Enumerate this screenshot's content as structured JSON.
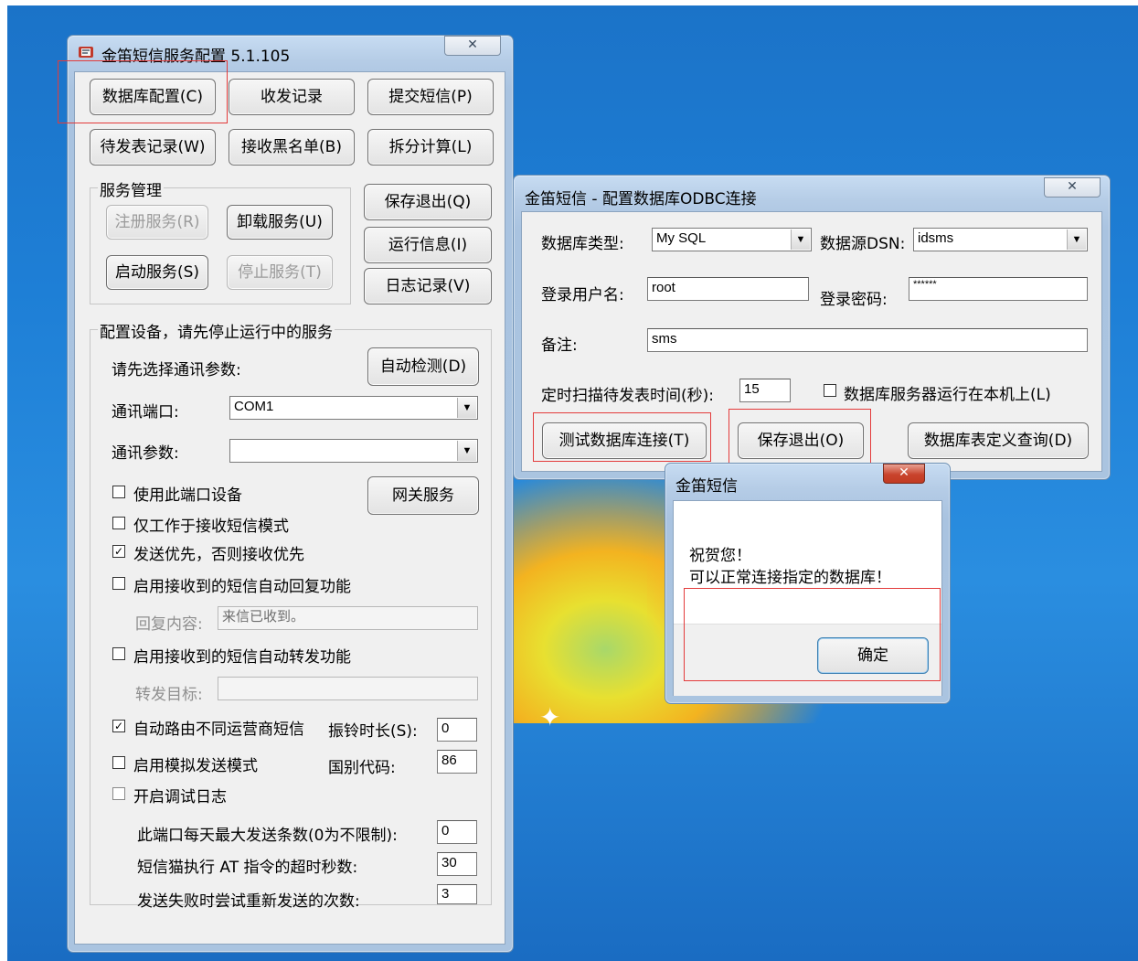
{
  "config_window": {
    "title": "金笛短信服务配置 5.1.105",
    "close_label": "✕",
    "top_buttons": [
      "数据库配置(C)",
      "收发记录",
      "提交短信(P)",
      "待发表记录(W)",
      "接收黑名单(B)",
      "拆分计算(L)"
    ],
    "service_group": {
      "legend": "服务管理",
      "register": "注册服务(R)",
      "uninstall": "卸载服务(U)",
      "start": "启动服务(S)",
      "stop": "停止服务(T)"
    },
    "save_exit": "保存退出(Q)",
    "run_info": "运行信息(I)",
    "log": "日志记录(V)",
    "device_group": {
      "legend": "配置设备，请先停止运行中的服务",
      "select_params_label": "请先选择通讯参数:",
      "auto_detect": "自动检测(D)",
      "port_label": "通讯端口:",
      "port_value": "COM1",
      "params_label": "通讯参数:",
      "params_value": "",
      "gateway": "网关服务",
      "use_port": "使用此端口设备",
      "receive_only": "仅工作于接收短信模式",
      "send_priority": "发送优先，否则接收优先",
      "auto_reply": "启用接收到的短信自动回复功能",
      "reply_label": "回复内容:",
      "reply_value": "来信已收到。",
      "auto_forward": "启用接收到的短信自动转发功能",
      "forward_label": "转发目标:",
      "forward_value": "",
      "auto_route": "自动路由不同运营商短信",
      "ring_label": "振铃时长(S):",
      "ring_value": "0",
      "simulate": "启用模拟发送模式",
      "country_label": "国别代码:",
      "country_value": "86",
      "debug_log": "开启调试日志",
      "max_send_label": "此端口每天最大发送条数(0为不限制):",
      "max_send_value": "0",
      "at_timeout_label": "短信猫执行 AT 指令的超时秒数:",
      "at_timeout_value": "30",
      "retry_label": "发送失败时尝试重新发送的次数:",
      "retry_value": "3"
    },
    "checks": {
      "use_port": false,
      "receive_only": false,
      "send_priority": true,
      "auto_reply": false,
      "auto_forward": false,
      "auto_route": true,
      "simulate": false,
      "debug_log": false
    }
  },
  "odbc_window": {
    "title": "金笛短信 - 配置数据库ODBC连接",
    "close_label": "✕",
    "db_type_label": "数据库类型:",
    "db_type_value": "My SQL",
    "dsn_label": "数据源DSN:",
    "dsn_value": "idsms",
    "user_label": "登录用户名:",
    "user_value": "root",
    "password_label": "登录密码:",
    "password_value": "******",
    "note_label": "备注:",
    "note_value": "sms",
    "scan_label": "定时扫描待发表时间(秒):",
    "scan_value": "15",
    "local_label": "数据库服务器运行在本机上(L)",
    "local_checked": false,
    "test_button": "测试数据库连接(T)",
    "save_button": "保存退出(O)",
    "query_button": "数据库表定义查询(D)"
  },
  "message_box": {
    "title": "金笛短信",
    "close_label": "✕",
    "line1": "祝贺您！",
    "line2": "可以正常连接指定的数据库！",
    "ok_button": "确定"
  }
}
